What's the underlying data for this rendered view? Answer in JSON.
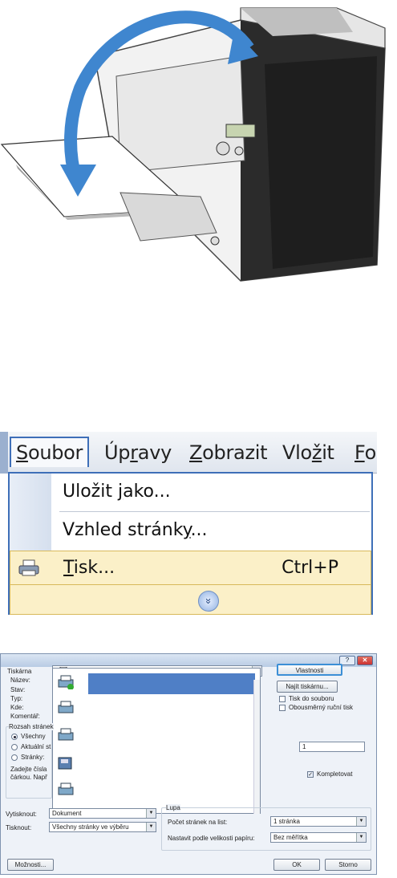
{
  "menu": {
    "bar_items": [
      {
        "text": "Soubor",
        "u": "S",
        "rest": "oubor"
      },
      {
        "text": "Úpravy",
        "pre": "Úp",
        "u": "r",
        "rest": "avy"
      },
      {
        "text": "Zobrazit",
        "u": "Z",
        "rest": "obrazit"
      },
      {
        "text": "Vložit",
        "pre": "Vlo",
        "u": "ž",
        "rest": "it"
      },
      {
        "text": "Fo",
        "u": "F",
        "rest": "o"
      }
    ],
    "items": [
      {
        "pre": "Uložit ",
        "u": "j",
        "rest": "ako..."
      },
      {
        "pre": "Vzhled stránk",
        "u": "y",
        "rest": "..."
      },
      {
        "pre": "",
        "u": "T",
        "rest": "isk...",
        "shortcut": "Ctrl+P"
      }
    ],
    "expand_glyph": "»",
    "colors": {
      "accent": "#3e6fb8",
      "highlight": "#fbf0c8"
    }
  },
  "dialog": {
    "section_printer": "Tiskárna",
    "name_label": "Název:",
    "status_label": "Stav:",
    "type_label": "Typ:",
    "where_label": "Kde:",
    "comment_label": "Komentář:",
    "properties_button": "Vlastnosti",
    "find_printer_button": "Najít tiskárnu...",
    "print_to_file": "Tisk do souboru",
    "duplex": "Obousměrný ruční tisk",
    "range_label": "Rozsah stránek",
    "range_all": "Všechny",
    "range_current": "Aktuální st",
    "range_pages": "Stránky:",
    "range_hint_1": "Zadejte čísla",
    "range_hint_2": "čárkou. Např",
    "copies_value": "1",
    "collate": "Kompletovat",
    "zoom_label": "Lupa",
    "pages_per_sheet_label": "Počet stránek na list:",
    "pages_per_sheet_value": "1 stránka",
    "scale_label": "Nastavit podle velikosti papíru:",
    "scale_value": "Bez měřítka",
    "print_what_label": "Vytisknout:",
    "print_what_value": "Dokument",
    "print_label": "Tisknout:",
    "print_value": "Všechny stránky ve výběru",
    "options_button": "Možnosti...",
    "ok_button": "OK",
    "cancel_button": "Storno",
    "help_glyph": "?",
    "close_glyph": "✕"
  }
}
